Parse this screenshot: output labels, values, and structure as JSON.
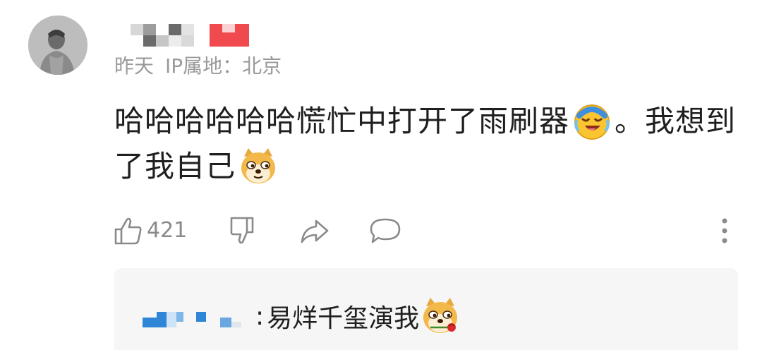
{
  "comment": {
    "username_display": "pixelated",
    "time": "昨天",
    "ip_location": "IP属地：北京",
    "text_line1": "哈哈哈哈哈哈慌忙中打开了雨刷器",
    "text_line1_tail": "。我想到",
    "text_line2": "了我自己",
    "emojis": [
      "laughing-crying-face-icon",
      "doge-icon"
    ],
    "likes": "421"
  },
  "actions": {
    "like_icon": "thumbs-up-icon",
    "dislike_icon": "thumbs-down-icon",
    "share_icon": "share-arrow-icon",
    "comment_icon": "comment-bubble-icon",
    "more_icon": "more-vertical-icon"
  },
  "reply": {
    "colon": ":",
    "text": "易烊千玺演我",
    "emoji": "doge-rose-icon"
  },
  "colors": {
    "meta_gray": "#9a9a9a",
    "reply_bg": "#f6f6f6",
    "mosaic_red": "#f04a4f",
    "mosaic_blue": "#2f86d6"
  }
}
